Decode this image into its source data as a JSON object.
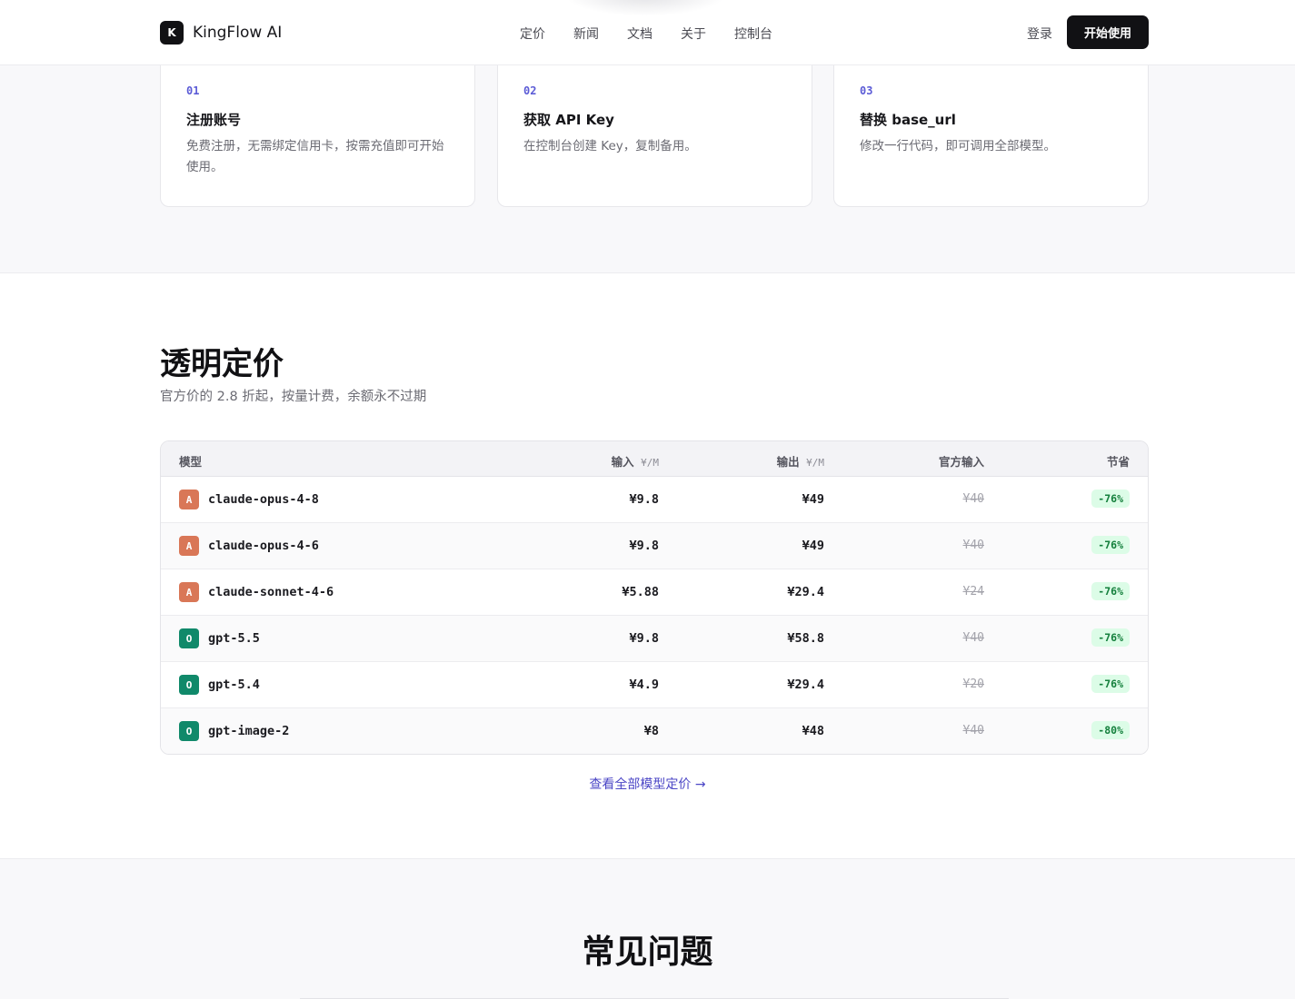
{
  "nav": {
    "brand_logo": "K",
    "brand_name": "KingFlow AI",
    "links": [
      "定价",
      "新闻",
      "文档",
      "关于",
      "控制台"
    ],
    "login": "登录",
    "start": "开始使用"
  },
  "steps": [
    {
      "num": "01",
      "title": "注册账号",
      "desc": "免费注册，无需绑定信用卡，按需充值即可开始使用。"
    },
    {
      "num": "02",
      "title": "获取 API Key",
      "desc": "在控制台创建 Key，复制备用。"
    },
    {
      "num": "03",
      "title": "替换 base_url",
      "desc": "修改一行代码，即可调用全部模型。"
    }
  ],
  "pricing": {
    "title": "透明定价",
    "subtitle": "官方价的 2.8 折起，按量计费，余额永不过期",
    "headers": {
      "model": "模型",
      "input": "输入",
      "input_unit": "¥/M",
      "output": "输出",
      "output_unit": "¥/M",
      "official": "官方输入",
      "save": "节省"
    },
    "rows": [
      {
        "provider": "A",
        "provider_color": "#d97757",
        "model": "claude-opus-4-8",
        "input": "¥9.8",
        "output": "¥49",
        "official": "¥40",
        "save": "-76%"
      },
      {
        "provider": "A",
        "provider_color": "#d97757",
        "model": "claude-opus-4-6",
        "input": "¥9.8",
        "output": "¥49",
        "official": "¥40",
        "save": "-76%"
      },
      {
        "provider": "A",
        "provider_color": "#d97757",
        "model": "claude-sonnet-4-6",
        "input": "¥5.88",
        "output": "¥29.4",
        "official": "¥24",
        "save": "-76%"
      },
      {
        "provider": "O",
        "provider_color": "#10896a",
        "model": "gpt-5.5",
        "input": "¥9.8",
        "output": "¥58.8",
        "official": "¥40",
        "save": "-76%"
      },
      {
        "provider": "O",
        "provider_color": "#10896a",
        "model": "gpt-5.4",
        "input": "¥4.9",
        "output": "¥29.4",
        "official": "¥20",
        "save": "-76%"
      },
      {
        "provider": "O",
        "provider_color": "#10896a",
        "model": "gpt-image-2",
        "input": "¥8",
        "output": "¥48",
        "official": "¥40",
        "save": "-80%"
      }
    ],
    "view_all": "查看全部模型定价 →"
  },
  "faq": {
    "title": "常见问题"
  }
}
